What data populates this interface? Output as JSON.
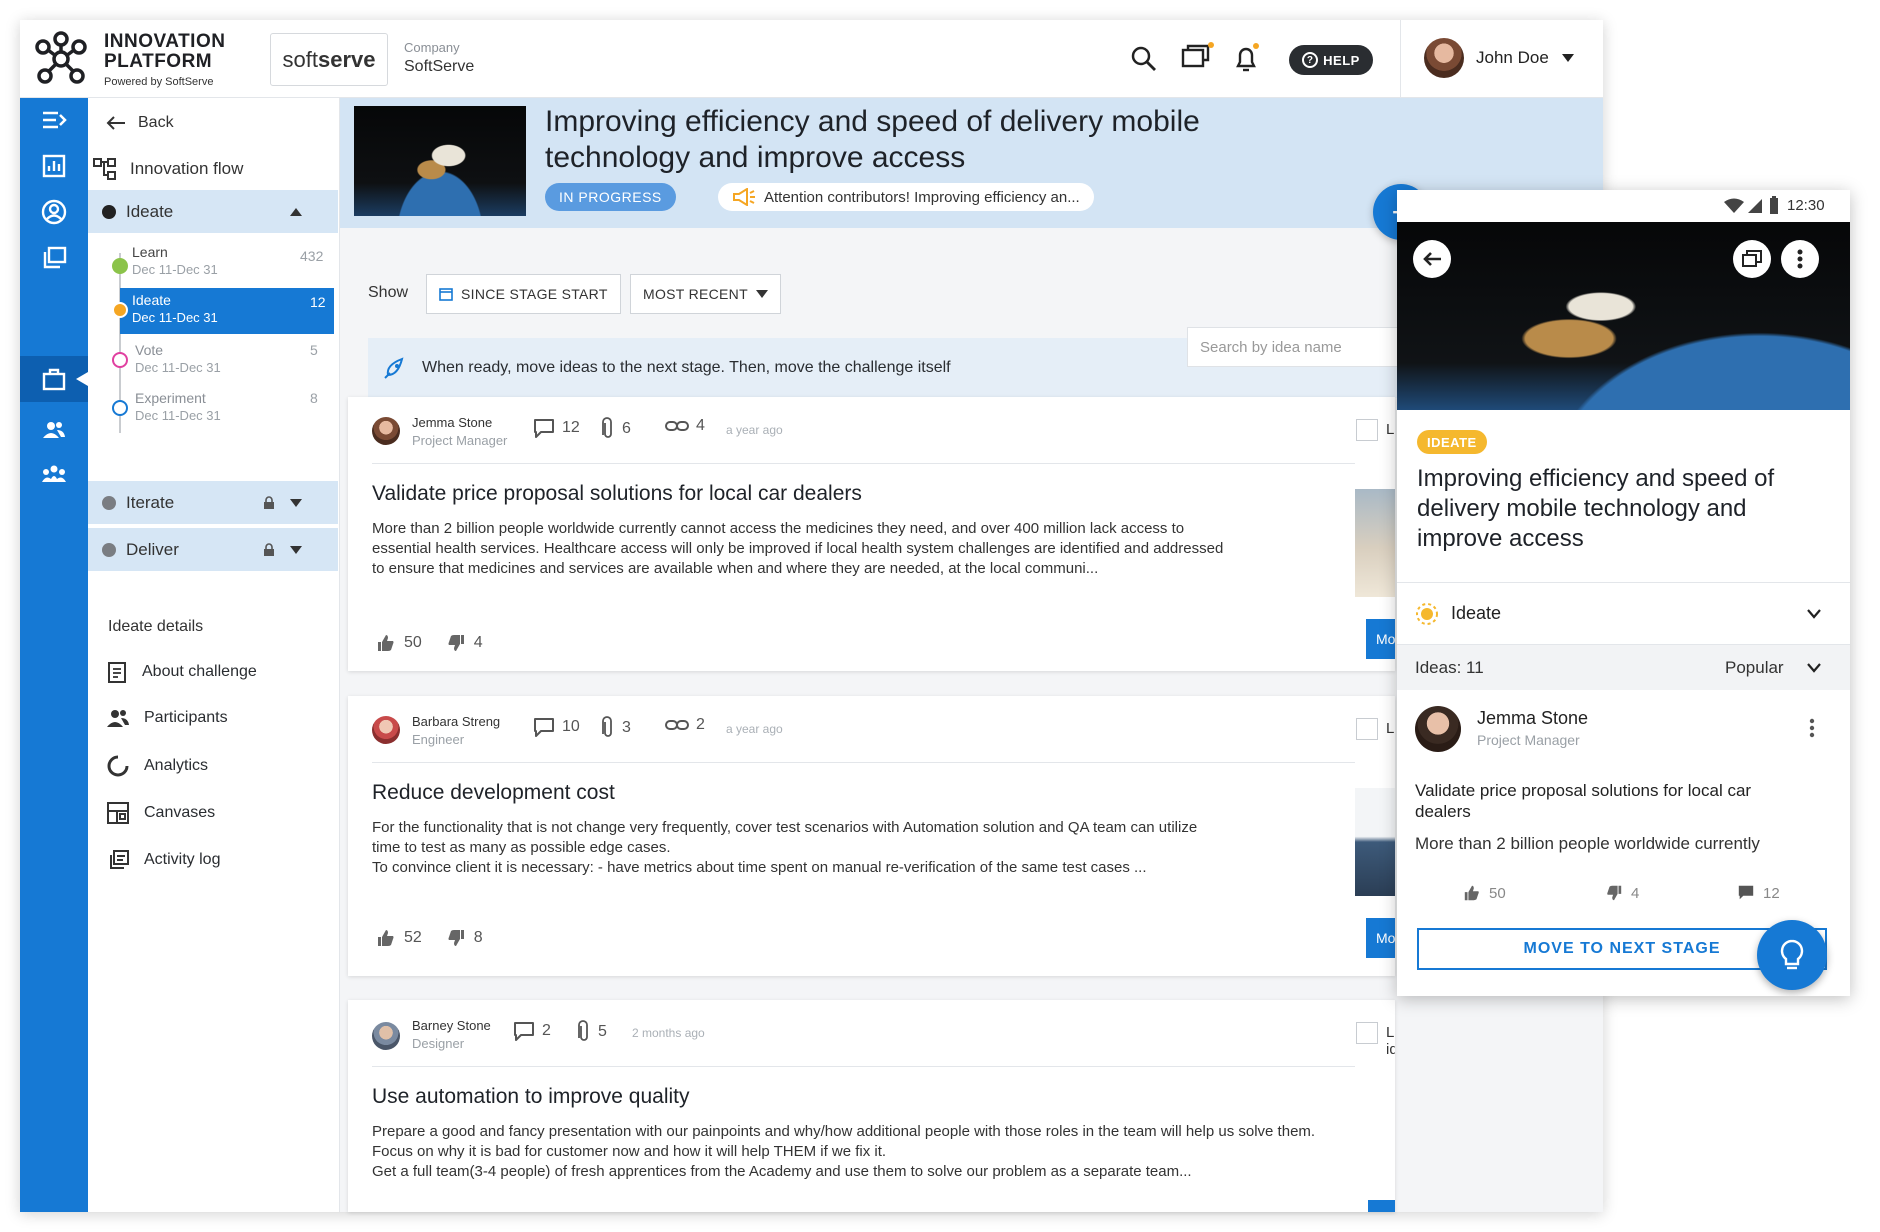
{
  "app": {
    "logo_line1": "INNOVATION",
    "logo_line2": "PLATFORM",
    "logo_sub": "Powered by SoftServe",
    "partner_logo_a": "soft",
    "partner_logo_b": "serve",
    "company_label": "Company",
    "company_name": "SoftServe",
    "help_label": "HELP",
    "user_name": "John Doe"
  },
  "nav": {
    "back": "Back",
    "flow": "Innovation flow",
    "stages": [
      {
        "label": "Ideate"
      },
      {
        "label": "Iterate"
      },
      {
        "label": "Deliver"
      }
    ],
    "sub_stages": [
      {
        "title": "Learn",
        "date": "Dec 11-Dec 31",
        "count": "432",
        "color": "#8bc34a"
      },
      {
        "title": "Ideate",
        "date": "Dec 11-Dec 31",
        "count": "12",
        "color": "#f5a623"
      },
      {
        "title": "Vote",
        "date": "Dec 11-Dec 31",
        "count": "5",
        "color": "#e040a0"
      },
      {
        "title": "Experiment",
        "date": "Dec 11-Dec 31",
        "count": "8",
        "color": "#1679d4"
      }
    ],
    "details_title": "Ideate details",
    "details": [
      {
        "label": "About challenge",
        "icon": "clipboard-icon"
      },
      {
        "label": "Participants",
        "icon": "people-icon"
      },
      {
        "label": "Analytics",
        "icon": "donut-icon"
      },
      {
        "label": "Canvases",
        "icon": "canvas-icon"
      },
      {
        "label": "Activity log",
        "icon": "log-icon"
      }
    ]
  },
  "challenge": {
    "title_line1": "Improving efficiency and speed of delivery mobile",
    "title_line2": "technology and improve access",
    "status": "IN PROGRESS",
    "announcement": "Attention contributors! Improving efficiency an..."
  },
  "filters": {
    "show_label": "Show",
    "since": "SINCE STAGE START",
    "sort": "MOST RECENT"
  },
  "banner": {
    "text": "When ready, move ideas to the next stage. Then, move the challenge itself",
    "search_placeholder": "Search by idea name"
  },
  "ideas": [
    {
      "author": "Jemma Stone",
      "role": "Project Manager",
      "comments": "12",
      "attachments": "6",
      "links": "4",
      "ago": "a year ago",
      "title": "Validate price proposal solutions for local car dealers",
      "body1": "More than 2 billion people worldwide currently cannot access the medicines they need, and over 400 million lack access to",
      "body2": "essential health services. Healthcare access will only be improved if local health system challenges are identified and addressed",
      "body3": "to ensure that medicines and services are available when and where they are needed, at the local communi...",
      "likes": "50",
      "dislikes": "4",
      "link_label": "L",
      "move_label": "Mo"
    },
    {
      "author": "Barbara Streng",
      "role": "Engineer",
      "comments": "10",
      "attachments": "3",
      "links": "2",
      "ago": "a year ago",
      "title": "Reduce development cost",
      "body1": "For the functionality that is not change very frequently, cover test scenarios with Automation solution and QA team can utilize",
      "body2": "time to test as many as possible edge cases.",
      "body3": "To convince client it is necessary: - have metrics about time spent on manual re-verification of the same test cases ...",
      "likes": "52",
      "dislikes": "8",
      "link_label": "L",
      "move_label": "Mo"
    },
    {
      "author": "Barney Stone",
      "role": "Designer",
      "comments": "2",
      "attachments": "5",
      "ago": "2 months ago",
      "link_label": "Link idea",
      "title": "Use automation to improve quality",
      "body1": "Prepare a good and fancy presentation with our painpoints and why/how additional people with those roles in the team will help us solve them.",
      "body2": "Focus on why it is bad for customer now and how it will help THEM if we fix it.",
      "body3": "Get a full team(3-4 people) of fresh apprentices from the Academy and use them to solve our problem as a separate team..."
    }
  ],
  "phone": {
    "time": "12:30",
    "tag": "IDEATE",
    "title_line1": "Improving efficiency and speed of",
    "title_line2": "delivery mobile technology and",
    "title_line3": "improve access",
    "stage": "Ideate",
    "ideas_count": "Ideas: 11",
    "sort": "Popular",
    "author": "Jemma Stone",
    "role": "Project Manager",
    "idea_title_line1": "Validate price proposal solutions for local car",
    "idea_title_line2": "dealers",
    "idea_body": "More than 2 billion people worldwide currently",
    "likes": "50",
    "dislikes": "4",
    "comments": "12",
    "move_label": "MOVE TO NEXT STAGE"
  },
  "colors": {
    "primary": "#1679d4",
    "rail": "#1679d4",
    "header_bg": "#d3e4f4",
    "tag_yellow": "#f5b82e"
  }
}
